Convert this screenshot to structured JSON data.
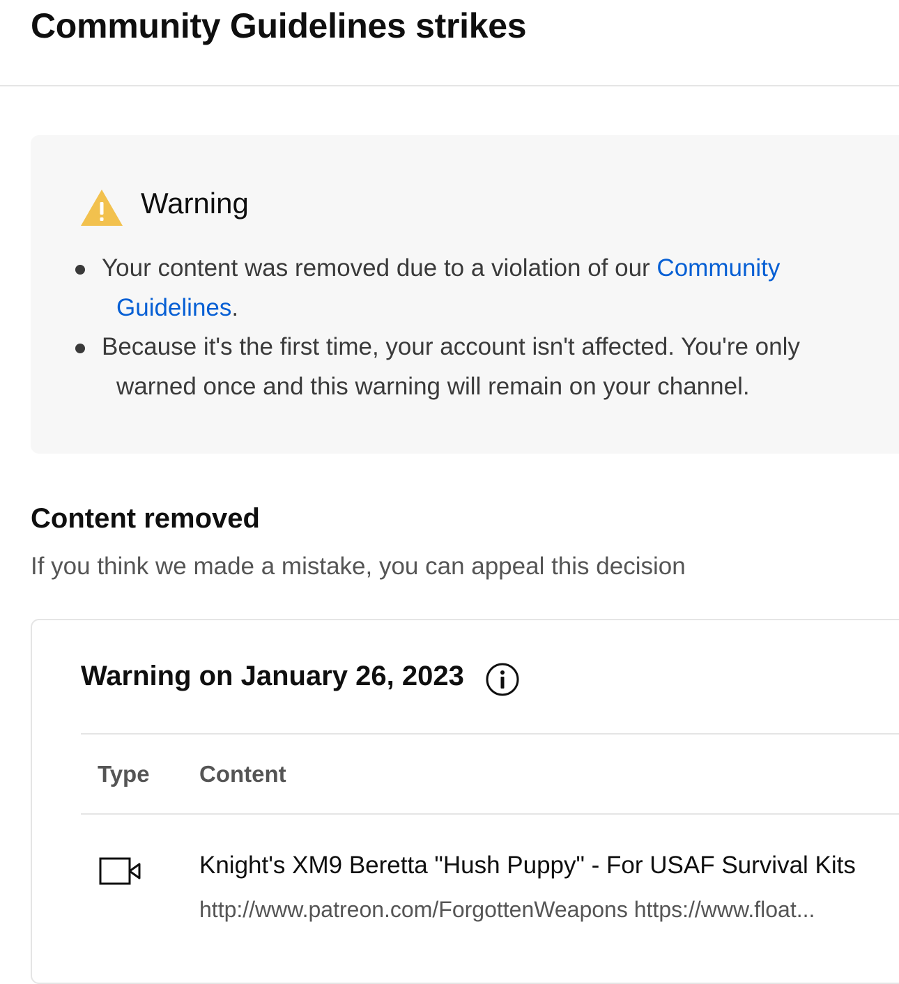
{
  "header": {
    "title": "Community Guidelines strikes"
  },
  "warning_panel": {
    "icon": "warning-triangle-icon",
    "icon_color": "#f2c14e",
    "heading": "Warning",
    "bullets": [
      {
        "lines": [
          {
            "text": "Your content was removed due to a violation of our ",
            "link": "Community"
          },
          {
            "text": "",
            "link": "Guidelines",
            "suffix": "."
          }
        ]
      },
      {
        "lines": [
          {
            "text": "Because it's the first time, your account isn't affected. You're only"
          },
          {
            "text": "warned once and this warning will remain on your channel."
          }
        ]
      }
    ],
    "link_color": "#065fd4"
  },
  "content_removed": {
    "heading": "Content removed",
    "subtext": "If you think we made a mistake, you can appeal this decision"
  },
  "strike_card": {
    "title": "Warning on January 26, 2023",
    "info_icon": "info-icon",
    "columns": [
      "Type",
      "Content"
    ],
    "rows": [
      {
        "type_icon": "video-icon",
        "title": "Knight's XM9 Beretta \"Hush Puppy\" - For USAF Survival Kits",
        "description": "http://www.patreon.com/ForgottenWeapons https://www.float..."
      }
    ]
  }
}
